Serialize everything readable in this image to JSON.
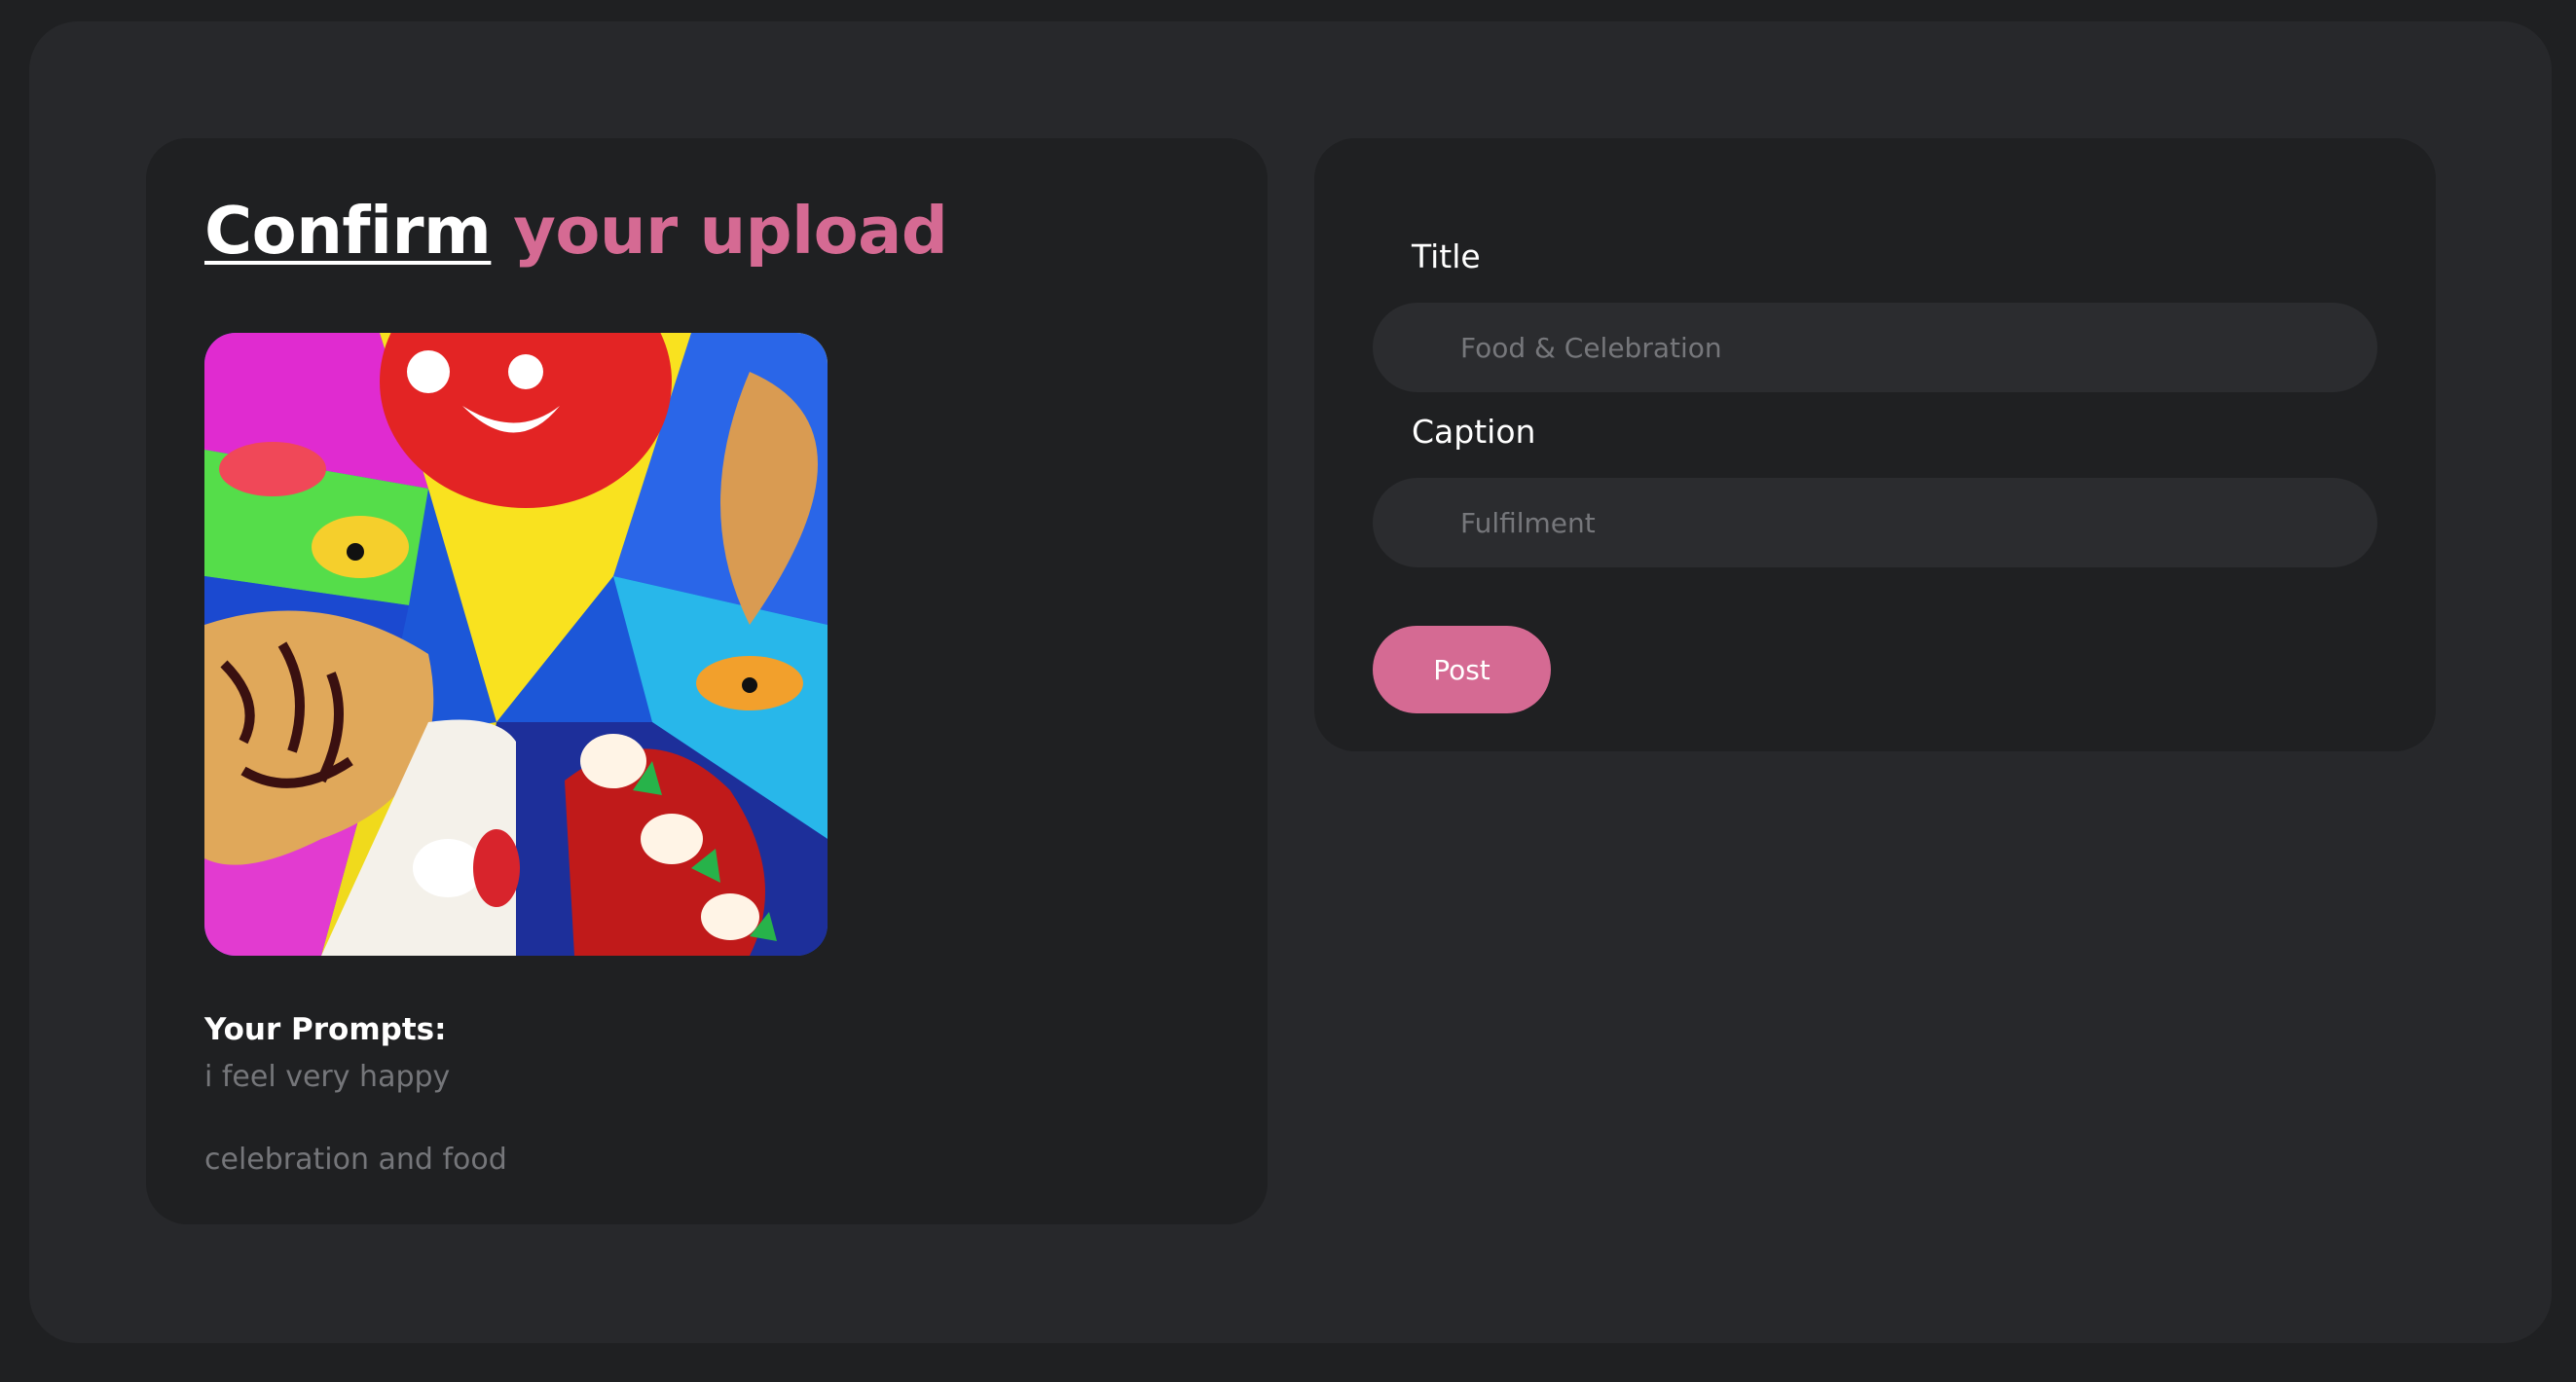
{
  "header": {
    "title_part1": "Confirm",
    "title_part2": "your upload"
  },
  "preview": {
    "image_name": "food-celebration-artwork"
  },
  "prompts": {
    "label": "Your Prompts:",
    "items": [
      "i feel very happy",
      "celebration and food"
    ]
  },
  "form": {
    "title_label": "Title",
    "title_value": "Food & Celebration",
    "caption_label": "Caption",
    "caption_value": "Fulfilment",
    "post_label": "Post"
  },
  "colors": {
    "accent": "#d56a93",
    "background": "#1f2022",
    "panel": "#27282b",
    "card": "#1f2022",
    "field": "#2b2c2f"
  }
}
